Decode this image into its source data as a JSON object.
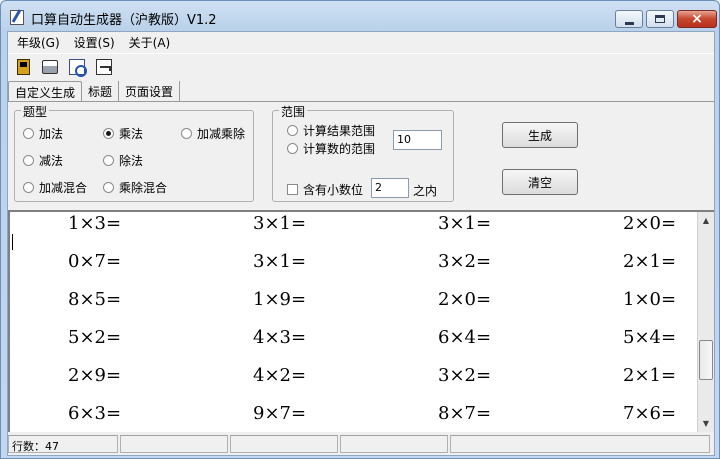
{
  "window": {
    "title": "口算自动生成器（沪教版）V1.2",
    "icon": "pencil-doc-icon",
    "controls": {
      "minimize": "minimize-icon",
      "maximize": "maximize-icon",
      "close": "×"
    }
  },
  "menu": [
    "年级(G)",
    "设置(S)",
    "关于(A)"
  ],
  "toolbar": [
    "save-icon",
    "print-icon",
    "print-preview-icon",
    "open-icon"
  ],
  "tabs": [
    "自定义生成",
    "标题",
    "页面设置"
  ],
  "question_type": {
    "label": "题型",
    "options": [
      {
        "label": "加法",
        "checked": false
      },
      {
        "label": "乘法",
        "checked": true
      },
      {
        "label": "加减乘除",
        "checked": false
      },
      {
        "label": "减法",
        "checked": false
      },
      {
        "label": "除法",
        "checked": false
      },
      {
        "label": "加减混合",
        "checked": false
      },
      {
        "label": "乘除混合",
        "checked": false
      }
    ]
  },
  "range": {
    "label": "范围",
    "option_result": "计算结果范围",
    "option_number": "计算数的范围",
    "value": "10",
    "decimal_label": "含有小数位",
    "decimal_value": "2",
    "decimal_suffix": "之内",
    "decimal_checked": false
  },
  "buttons": {
    "generate": "生成",
    "clear": "清空"
  },
  "problems": [
    [
      "1×3=",
      "3×1=",
      "3×1=",
      "2×0="
    ],
    [
      "0×7=",
      "3×1=",
      "3×2=",
      "2×1="
    ],
    [
      "8×5=",
      "1×9=",
      "2×0=",
      "1×0="
    ],
    [
      "5×2=",
      "4×3=",
      "6×4=",
      "5×4="
    ],
    [
      "2×9=",
      "4×2=",
      "3×2=",
      "2×1="
    ],
    [
      "6×3=",
      "9×7=",
      "8×7=",
      "7×6="
    ]
  ],
  "status": {
    "line_count": "行数：47",
    "cells": [
      "",
      "",
      "",
      ""
    ]
  },
  "colors": {
    "title_bar": "#c3d7ee",
    "close_button": "#c6462e",
    "sheet": "#ffffff"
  }
}
